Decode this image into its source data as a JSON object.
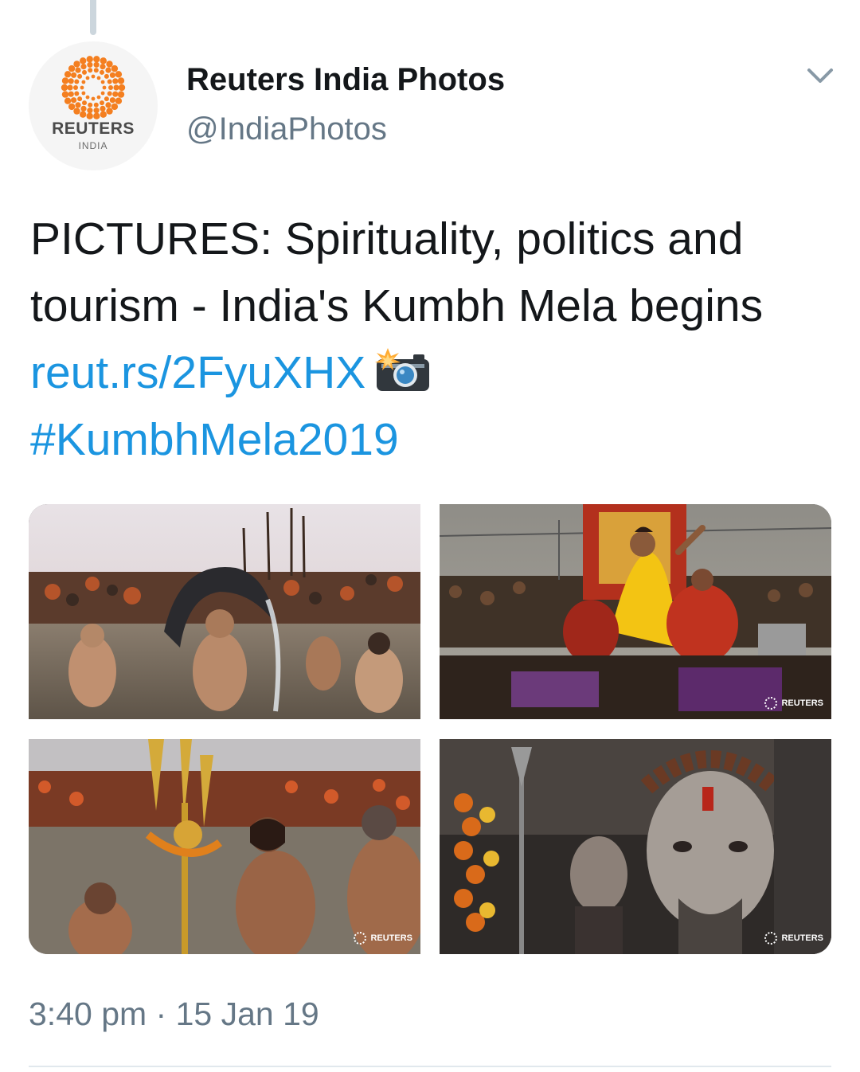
{
  "tweet": {
    "author": {
      "display_name": "Reuters India Photos",
      "handle": "@IndiaPhotos",
      "avatar": {
        "wordmark": "REUTERS",
        "subtitle": "INDIA",
        "brand_color": "#f47f20"
      }
    },
    "text": {
      "body": "PICTURES: Spirituality, politics and tourism - India's Kumbh Mela begins ",
      "link": "reut.rs/2FyuXHX",
      "emoji": "camera-with-flash-icon",
      "hashtag": "#KumbhMela2019"
    },
    "photos": [
      {
        "name": "photo-bathing-hair-splash",
        "watermark": ""
      },
      {
        "name": "photo-woman-in-yellow-on-float",
        "watermark": "REUTERS"
      },
      {
        "name": "photo-trident-bearer-in-river",
        "watermark": "REUTERS"
      },
      {
        "name": "photo-ash-covered-sadhu-portrait",
        "watermark": "REUTERS"
      }
    ],
    "timestamp": "3:40 pm · 15 Jan 19"
  },
  "colors": {
    "link": "#1b95e0",
    "secondary_text": "#657786",
    "primary_text": "#14171a",
    "divider": "#e1e8ed"
  }
}
